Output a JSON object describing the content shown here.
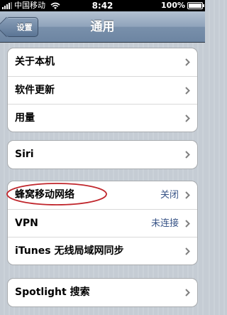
{
  "status_bar": {
    "carrier": "中国移动",
    "time": "8:42",
    "battery": "100%",
    "battery_level": 1.0
  },
  "nav": {
    "back_label": "设置",
    "title": "通用"
  },
  "groups": [
    {
      "items": [
        {
          "label": "关于本机",
          "value": ""
        },
        {
          "label": "软件更新",
          "value": ""
        },
        {
          "label": "用量",
          "value": ""
        }
      ]
    },
    {
      "items": [
        {
          "label": "Siri",
          "value": ""
        }
      ]
    },
    {
      "items": [
        {
          "label": "蜂窝移动网络",
          "value": "关闭"
        },
        {
          "label": "VPN",
          "value": "未连接"
        },
        {
          "label": "iTunes 无线局域网同步",
          "value": ""
        }
      ]
    },
    {
      "items": [
        {
          "label": "Spotlight 搜索",
          "value": ""
        }
      ]
    }
  ],
  "icons": {
    "signal": "signal-bars-icon",
    "wifi": "wifi-icon",
    "battery": "battery-icon",
    "chevron": "chevron-right-icon",
    "back": "back-arrow-icon"
  },
  "colors": {
    "nav_bar": "#7990ab",
    "background": "#c5ccd4",
    "value_text": "#385487",
    "chevron": "#7f7f7f",
    "annotation": "#c0262c"
  }
}
